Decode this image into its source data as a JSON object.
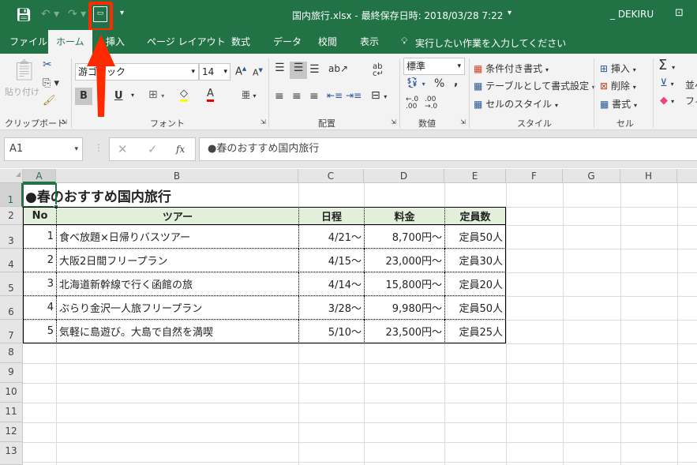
{
  "titlebar": {
    "title": "国内旅行.xlsx - 最終保存日時: 2018/03/28 7:22",
    "user": "_ DEKIRU"
  },
  "tabs": [
    "ファイル",
    "ホーム",
    "挿入",
    "ページ レイアウト",
    "数式",
    "データ",
    "校閲",
    "表示"
  ],
  "tell_me": "実行したい作業を入力してください",
  "ribbon": {
    "clipboard": {
      "paste": "貼り付け",
      "label": "クリップボード"
    },
    "font": {
      "name": "游ゴシック",
      "size": "14",
      "bold": "B",
      "underline": "U",
      "label": "フォント"
    },
    "alignment": {
      "label": "配置"
    },
    "number": {
      "format": "標準",
      "percent": "%",
      "comma": ",",
      "label": "数値"
    },
    "styles": {
      "conditional": "条件付き書式",
      "table": "テーブルとして書式設定",
      "cell_styles": "セルのスタイル",
      "label": "スタイル"
    },
    "cells": {
      "insert": "挿入",
      "delete": "削除",
      "format": "書式",
      "label": "セル"
    },
    "editing": {
      "sort": "並べ",
      "filter": "フィ"
    }
  },
  "namebox": "A1",
  "formula": "●春のおすすめ国内旅行",
  "columns": [
    "A",
    "B",
    "C",
    "D",
    "E",
    "F",
    "G",
    "H"
  ],
  "rows": [
    "1",
    "2",
    "3",
    "4",
    "5",
    "6",
    "7",
    "8",
    "9",
    "10",
    "11",
    "12",
    "13"
  ],
  "sheet": {
    "title": "●春のおすすめ国内旅行",
    "headers": [
      "No",
      "ツアー",
      "日程",
      "料金",
      "定員数"
    ],
    "data": [
      [
        "1",
        "食べ放題×日帰りバスツアー",
        "4/21～",
        "8,700円～",
        "定員50人"
      ],
      [
        "2",
        "大阪2日間フリープラン",
        "4/15～",
        "23,000円～",
        "定員30人"
      ],
      [
        "3",
        "北海道新幹線で行く函館の旅",
        "4/14～",
        "15,800円～",
        "定員20人"
      ],
      [
        "4",
        "ぶらり金沢一人旅フリープラン",
        "3/28～",
        "9,980円～",
        "定員50人"
      ],
      [
        "5",
        "気軽に島遊び。大島で自然を満喫",
        "5/10～",
        "23,500円～",
        "定員25人"
      ]
    ]
  },
  "colors": {
    "brand": "#217346",
    "header_fill": "#e2efda",
    "annotation": "#ff2a00"
  }
}
